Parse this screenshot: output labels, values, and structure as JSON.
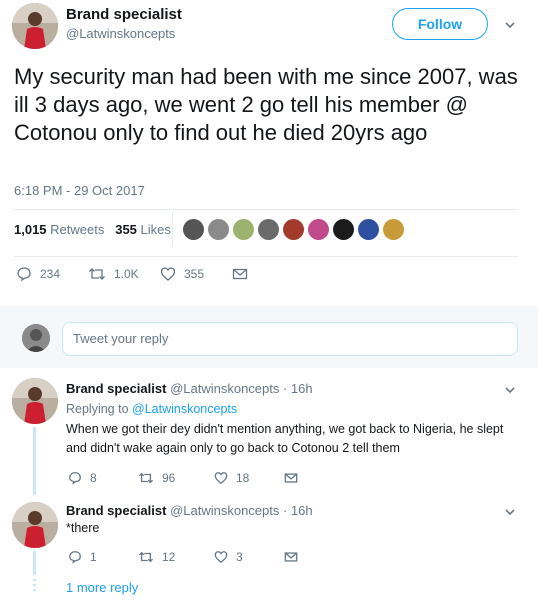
{
  "tweet": {
    "author_name": "Brand specialist",
    "author_handle": "@Latwinskoncepts",
    "follow_label": "Follow",
    "text": "My security man had been with me since 2007, was ill 3 days ago, we went 2 go tell his member @ Cotonou only to find out he died 20yrs ago",
    "timestamp": "6:18 PM - 29 Oct 2017",
    "retweets_count": "1,015",
    "retweets_label": "Retweets",
    "likes_count": "355",
    "likes_label": "Likes",
    "actions": {
      "replies": "234",
      "retweets": "1.0K",
      "likes": "355"
    }
  },
  "reply_box": {
    "placeholder": "Tweet your reply"
  },
  "replies": [
    {
      "author_name": "Brand specialist",
      "author_meta": "@Latwinskoncepts · 16h",
      "replying_prefix": "Replying to",
      "replying_handle": "@Latwinskoncepts",
      "line1": "When we got their dey didn't mention anything, we got back to Nigeria, he slept",
      "line2": "and didn't wake again only to go back to Cotonou 2 tell them",
      "actions": {
        "replies": "8",
        "retweets": "96",
        "likes": "18"
      }
    },
    {
      "author_name": "Brand specialist",
      "author_meta": "@Latwinskoncepts · 16h",
      "line1": "*there",
      "actions": {
        "replies": "1",
        "retweets": "12",
        "likes": "3"
      }
    }
  ],
  "more_replies_label": "1 more reply",
  "colors": {
    "accent": "#1da1f2",
    "muted": "#657786",
    "thread": "#c9e6fb"
  }
}
